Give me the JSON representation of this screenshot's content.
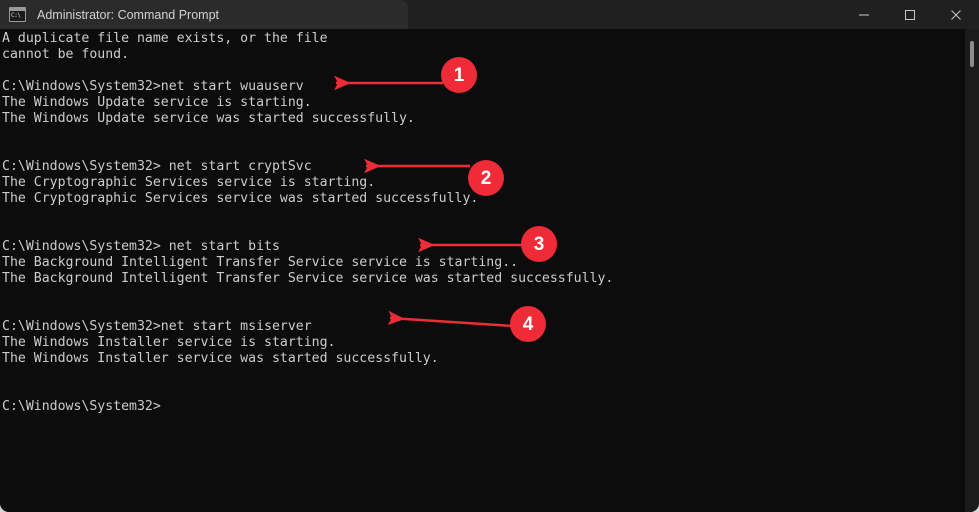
{
  "window": {
    "title": "Administrator: Command Prompt",
    "icon": "command-prompt-icon",
    "icon_text": "C:\\",
    "controls": {
      "minimize": "Minimize",
      "maximize": "Maximize",
      "close": "Close"
    }
  },
  "console": {
    "background_color": "#0c0c0c",
    "text_color": "#cccccc",
    "content": "A duplicate file name exists, or the file\ncannot be found.\n\nC:\\Windows\\System32>net start wuauserv\nThe Windows Update service is starting.\nThe Windows Update service was started successfully.\n\n\nC:\\Windows\\System32> net start cryptSvc\nThe Cryptographic Services service is starting.\nThe Cryptographic Services service was started successfully.\n\n\nC:\\Windows\\System32> net start bits\nThe Background Intelligent Transfer Service service is starting..\nThe Background Intelligent Transfer Service service was started successfully.\n\n\nC:\\Windows\\System32>net start msiserver\nThe Windows Installer service is starting.\nThe Windows Installer service was started successfully.\n\n\nC:\\Windows\\System32>",
    "lines": [
      "A duplicate file name exists, or the file",
      "cannot be found.",
      "",
      "C:\\Windows\\System32>net start wuauserv",
      "The Windows Update service is starting.",
      "The Windows Update service was started successfully.",
      "",
      "",
      "C:\\Windows\\System32> net start cryptSvc",
      "The Cryptographic Services service is starting.",
      "The Cryptographic Services service was started successfully.",
      "",
      "",
      "C:\\Windows\\System32> net start bits",
      "The Background Intelligent Transfer Service service is starting..",
      "The Background Intelligent Transfer Service service was started successfully.",
      "",
      "",
      "C:\\Windows\\System32>net start msiserver",
      "The Windows Installer service is starting.",
      "The Windows Installer service was started successfully.",
      "",
      "",
      "C:\\Windows\\System32>"
    ]
  },
  "annotations": {
    "color": "#ee2b37",
    "badges": [
      {
        "label": "1",
        "target_line": "C:\\Windows\\System32>net start wuauserv"
      },
      {
        "label": "2",
        "target_line": "C:\\Windows\\System32> net start cryptSvc"
      },
      {
        "label": "3",
        "target_line": "C:\\Windows\\System32> net start bits"
      },
      {
        "label": "4",
        "target_line": "C:\\Windows\\System32>net start msiserver"
      }
    ]
  },
  "scrollbar": {
    "orientation": "vertical",
    "position": "top"
  }
}
